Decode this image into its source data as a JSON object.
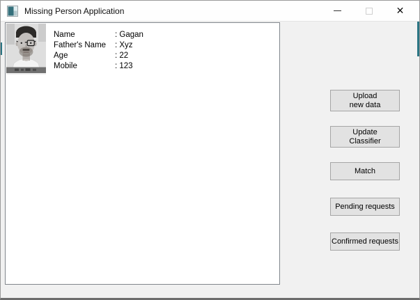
{
  "window": {
    "title": "Missing Person Application"
  },
  "titlebar": {
    "minimize_icon": "minimize-line",
    "maximize_icon": "maximize-square",
    "close_glyph": "✕"
  },
  "person": {
    "photo": "grayscale-portrait-of-man-with-glasses",
    "fields": [
      {
        "label": "Name",
        "value": ": Gagan"
      },
      {
        "label": "Father's Name",
        "value": ": Xyz"
      },
      {
        "label": "Age",
        "value": ": 22"
      },
      {
        "label": "Mobile",
        "value": ": 123"
      }
    ]
  },
  "buttons": [
    {
      "id": "upload-new-data",
      "label": "Upload\nnew data"
    },
    {
      "id": "update-classifier",
      "label": "Update\nClassifier"
    },
    {
      "id": "match",
      "label": "Match"
    },
    {
      "id": "pending-requests",
      "label": "Pending requests"
    },
    {
      "id": "confirmed-requests",
      "label": "Confirmed requests"
    }
  ],
  "colors": {
    "titlebar_bg": "#fefefe",
    "window_bg": "#f1f1f1",
    "panel_bg": "#ffffff",
    "panel_border": "#81868c",
    "button_bg": "#e2e2e2",
    "button_border": "#a5a5a5",
    "window_border": "#9a9a9a",
    "accent_edge_teal": "#2a7583"
  }
}
